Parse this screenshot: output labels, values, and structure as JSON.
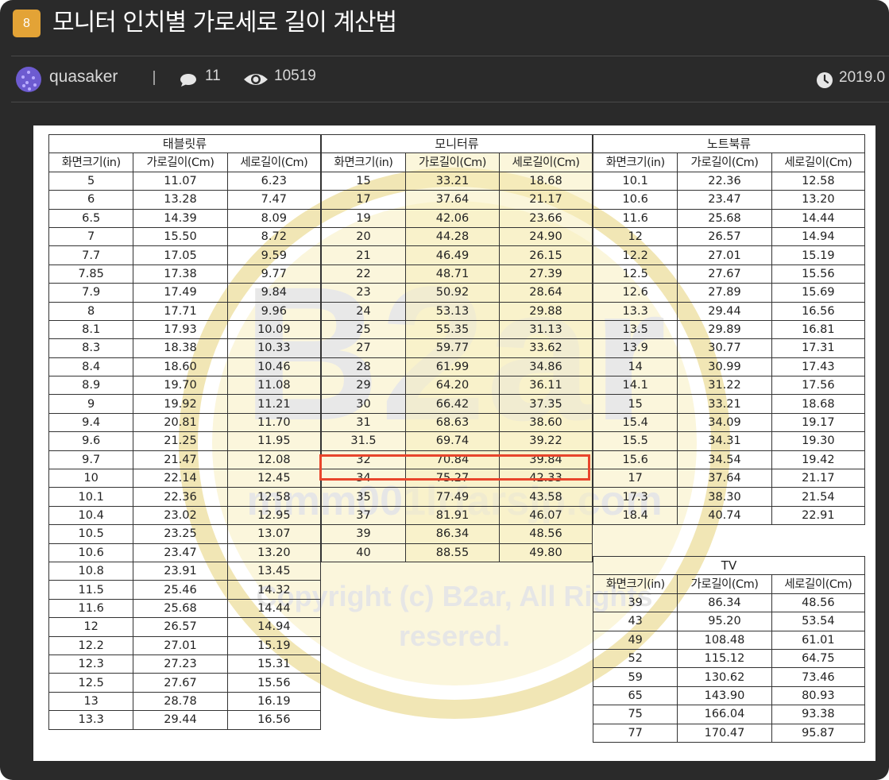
{
  "post": {
    "number": "8",
    "title": "모니터 인치별 가로세로 길이 계산법",
    "author": "quasaker",
    "comment_count": "11",
    "view_count": "10519",
    "date": "2019.0"
  },
  "icons": {
    "comment": "comment-bubble-icon",
    "views": "eye-icon",
    "date": "clock-icon",
    "avatar": "avatar"
  },
  "colors": {
    "badge": "#e3a336",
    "background": "#2a2a2a",
    "avatar": "#6d5bd0",
    "highlight": "#e8452c"
  },
  "image": {
    "watermark": {
      "brand": "B2ar",
      "site": "mmm001lrfarsjp.com",
      "copyright_line1": "Copyright (c) B2ar, All Rights",
      "copyright_line2": "resered."
    },
    "column_headers": [
      "화면크기(in)",
      "가로길이(Cm)",
      "세로길이(Cm)"
    ],
    "tablet": {
      "title": "태블릿류",
      "rows": [
        [
          "5",
          "11.07",
          "6.23"
        ],
        [
          "6",
          "13.28",
          "7.47"
        ],
        [
          "6.5",
          "14.39",
          "8.09"
        ],
        [
          "7",
          "15.50",
          "8.72"
        ],
        [
          "7.7",
          "17.05",
          "9.59"
        ],
        [
          "7.85",
          "17.38",
          "9.77"
        ],
        [
          "7.9",
          "17.49",
          "9.84"
        ],
        [
          "8",
          "17.71",
          "9.96"
        ],
        [
          "8.1",
          "17.93",
          "10.09"
        ],
        [
          "8.3",
          "18.38",
          "10.33"
        ],
        [
          "8.4",
          "18.60",
          "10.46"
        ],
        [
          "8.9",
          "19.70",
          "11.08"
        ],
        [
          "9",
          "19.92",
          "11.21"
        ],
        [
          "9.4",
          "20.81",
          "11.70"
        ],
        [
          "9.6",
          "21.25",
          "11.95"
        ],
        [
          "9.7",
          "21.47",
          "12.08"
        ],
        [
          "10",
          "22.14",
          "12.45"
        ],
        [
          "10.1",
          "22.36",
          "12.58"
        ],
        [
          "10.4",
          "23.02",
          "12.95"
        ],
        [
          "10.5",
          "23.25",
          "13.07"
        ],
        [
          "10.6",
          "23.47",
          "13.20"
        ],
        [
          "10.8",
          "23.91",
          "13.45"
        ],
        [
          "11.5",
          "25.46",
          "14.32"
        ],
        [
          "11.6",
          "25.68",
          "14.44"
        ],
        [
          "12",
          "26.57",
          "14.94"
        ],
        [
          "12.2",
          "27.01",
          "15.19"
        ],
        [
          "12.3",
          "27.23",
          "15.31"
        ],
        [
          "12.5",
          "27.67",
          "15.56"
        ],
        [
          "13",
          "28.78",
          "16.19"
        ],
        [
          "13.3",
          "29.44",
          "16.56"
        ]
      ]
    },
    "monitor": {
      "title": "모니터류",
      "highlighted_row": 15,
      "rows": [
        [
          "15",
          "33.21",
          "18.68"
        ],
        [
          "17",
          "37.64",
          "21.17"
        ],
        [
          "19",
          "42.06",
          "23.66"
        ],
        [
          "20",
          "44.28",
          "24.90"
        ],
        [
          "21",
          "46.49",
          "26.15"
        ],
        [
          "22",
          "48.71",
          "27.39"
        ],
        [
          "23",
          "50.92",
          "28.64"
        ],
        [
          "24",
          "53.13",
          "29.88"
        ],
        [
          "25",
          "55.35",
          "31.13"
        ],
        [
          "27",
          "59.77",
          "33.62"
        ],
        [
          "28",
          "61.99",
          "34.86"
        ],
        [
          "29",
          "64.20",
          "36.11"
        ],
        [
          "30",
          "66.42",
          "37.35"
        ],
        [
          "31",
          "68.63",
          "38.60"
        ],
        [
          "31.5",
          "69.74",
          "39.22"
        ],
        [
          "32",
          "70.84",
          "39.84"
        ],
        [
          "34",
          "75.27",
          "42.33"
        ],
        [
          "35",
          "77.49",
          "43.58"
        ],
        [
          "37",
          "81.91",
          "46.07"
        ],
        [
          "39",
          "86.34",
          "48.56"
        ],
        [
          "40",
          "88.55",
          "49.80"
        ]
      ]
    },
    "laptop": {
      "title": "노트북류",
      "rows": [
        [
          "10.1",
          "22.36",
          "12.58"
        ],
        [
          "10.6",
          "23.47",
          "13.20"
        ],
        [
          "11.6",
          "25.68",
          "14.44"
        ],
        [
          "12",
          "26.57",
          "14.94"
        ],
        [
          "12.2",
          "27.01",
          "15.19"
        ],
        [
          "12.5",
          "27.67",
          "15.56"
        ],
        [
          "12.6",
          "27.89",
          "15.69"
        ],
        [
          "13.3",
          "29.44",
          "16.56"
        ],
        [
          "13.5",
          "29.89",
          "16.81"
        ],
        [
          "13.9",
          "30.77",
          "17.31"
        ],
        [
          "14",
          "30.99",
          "17.43"
        ],
        [
          "14.1",
          "31.22",
          "17.56"
        ],
        [
          "15",
          "33.21",
          "18.68"
        ],
        [
          "15.4",
          "34.09",
          "19.17"
        ],
        [
          "15.5",
          "34.31",
          "19.30"
        ],
        [
          "15.6",
          "34.54",
          "19.42"
        ],
        [
          "17",
          "37.64",
          "21.17"
        ],
        [
          "17.3",
          "38.30",
          "21.54"
        ],
        [
          "18.4",
          "40.74",
          "22.91"
        ]
      ]
    },
    "tv": {
      "title": "TV",
      "rows": [
        [
          "39",
          "86.34",
          "48.56"
        ],
        [
          "43",
          "95.20",
          "53.54"
        ],
        [
          "49",
          "108.48",
          "61.01"
        ],
        [
          "52",
          "115.12",
          "64.75"
        ],
        [
          "59",
          "130.62",
          "73.46"
        ],
        [
          "65",
          "143.90",
          "80.93"
        ],
        [
          "75",
          "166.04",
          "93.38"
        ],
        [
          "77",
          "170.47",
          "95.87"
        ]
      ]
    }
  }
}
